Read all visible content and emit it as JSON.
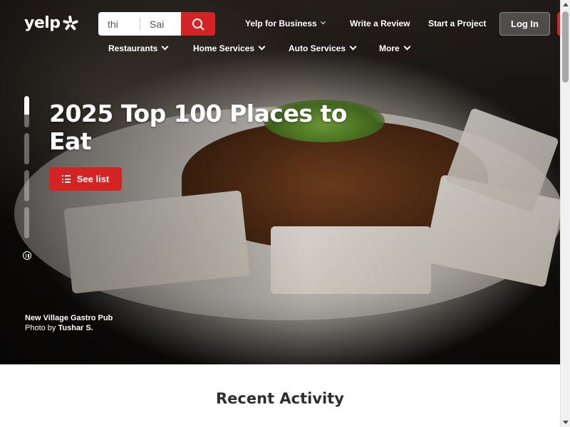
{
  "brand": {
    "logo_text": "yelp",
    "accent": "#d32323"
  },
  "search": {
    "find_value": "thi",
    "near_value": "Sai",
    "button_icon": "search-icon"
  },
  "header": {
    "for_business": "Yelp for Business",
    "write_review": "Write a Review",
    "start_project": "Start a Project",
    "log_in": "Log In"
  },
  "categories": [
    {
      "label": "Restaurants"
    },
    {
      "label": "Home Services"
    },
    {
      "label": "Auto Services"
    },
    {
      "label": "More"
    }
  ],
  "hero": {
    "headline": "2025 Top 100 Places to Eat",
    "cta_label": "See list",
    "cta_icon": "list-icon",
    "slides_total": 4,
    "current_slide": 1,
    "current_slide_progress": 0.6,
    "photo_place": "New Village Gastro Pub",
    "photo_by_prefix": "Photo by",
    "photo_author": "Tushar S."
  },
  "sections": {
    "recent_activity": "Recent Activity"
  }
}
